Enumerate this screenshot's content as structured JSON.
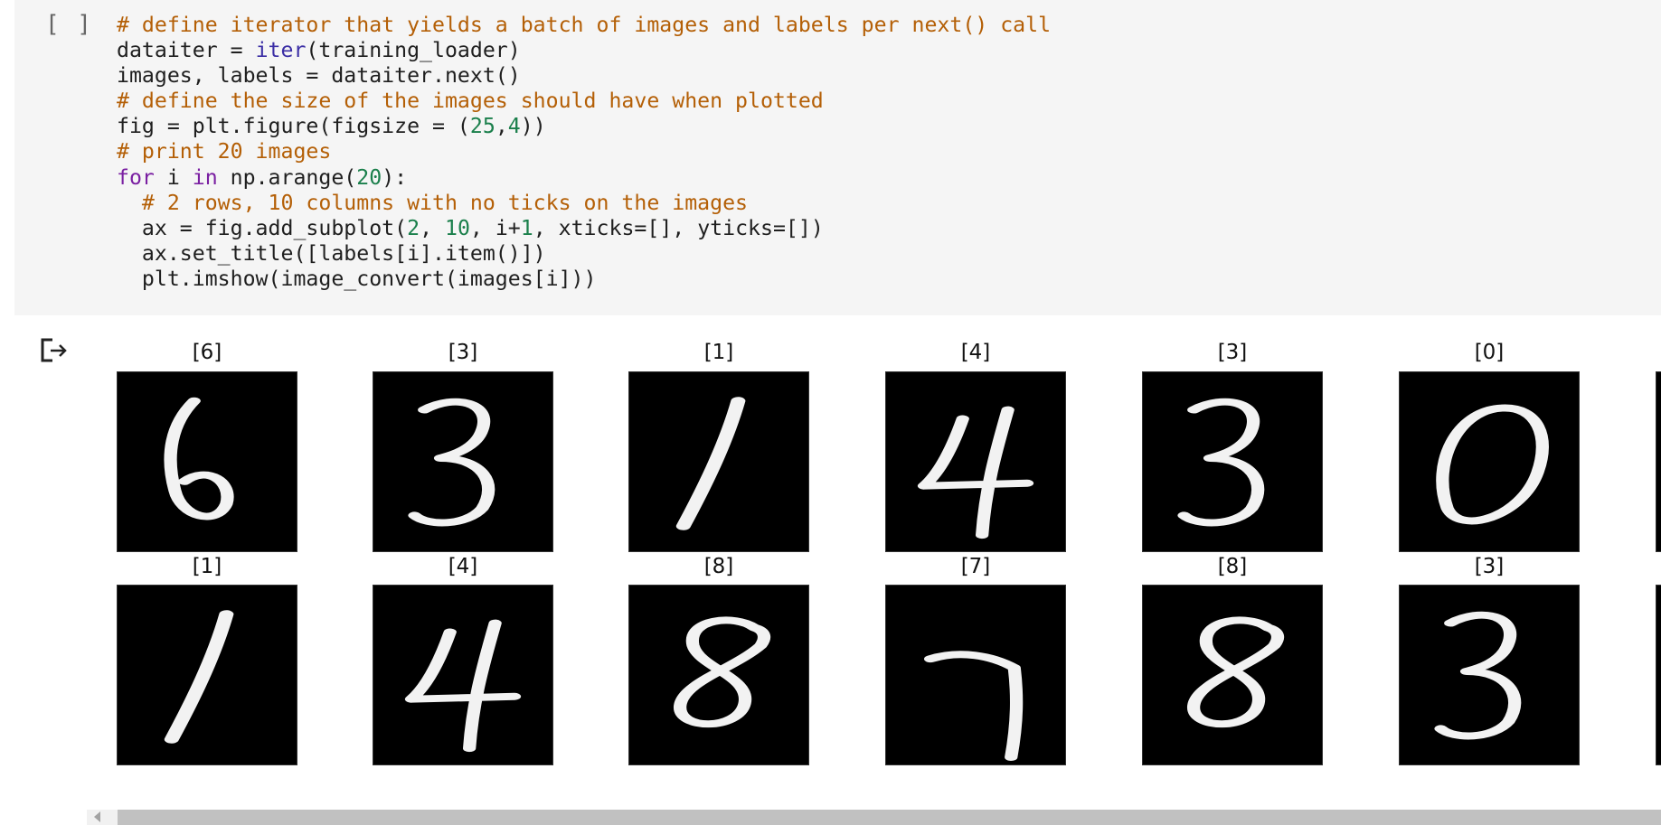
{
  "cell": {
    "run_indicator": "[ ]",
    "code_lines": [
      [
        {
          "t": "c",
          "s": "# define iterator that yields a batch of images and labels per next() call"
        }
      ],
      [
        {
          "t": "x",
          "s": "dataiter = "
        },
        {
          "t": "b",
          "s": "iter"
        },
        {
          "t": "x",
          "s": "(training_loader)"
        }
      ],
      [
        {
          "t": "x",
          "s": "images, labels = dataiter.next()"
        }
      ],
      [
        {
          "t": "c",
          "s": "# define the size of the images should have when plotted"
        }
      ],
      [
        {
          "t": "x",
          "s": "fig = plt.figure(figsize = ("
        },
        {
          "t": "n",
          "s": "25"
        },
        {
          "t": "x",
          "s": ","
        },
        {
          "t": "n",
          "s": "4"
        },
        {
          "t": "x",
          "s": "))"
        }
      ],
      [
        {
          "t": "c",
          "s": "# print 20 images"
        }
      ],
      [
        {
          "t": "k",
          "s": "for"
        },
        {
          "t": "x",
          "s": " i "
        },
        {
          "t": "k",
          "s": "in"
        },
        {
          "t": "x",
          "s": " np.arange("
        },
        {
          "t": "n",
          "s": "20"
        },
        {
          "t": "x",
          "s": "):"
        }
      ],
      [
        {
          "t": "x",
          "s": "  "
        },
        {
          "t": "c",
          "s": "# 2 rows, 10 columns with no ticks on the images"
        }
      ],
      [
        {
          "t": "x",
          "s": "  ax = fig.add_subplot("
        },
        {
          "t": "n",
          "s": "2"
        },
        {
          "t": "x",
          "s": ", "
        },
        {
          "t": "n",
          "s": "10"
        },
        {
          "t": "x",
          "s": ", i+"
        },
        {
          "t": "n",
          "s": "1"
        },
        {
          "t": "x",
          "s": ", xticks=[], yticks=[])"
        }
      ],
      [
        {
          "t": "x",
          "s": "  ax.set_title([labels[i].item()])"
        }
      ],
      [
        {
          "t": "x",
          "s": "  plt.imshow(image_convert(images[i]))"
        }
      ]
    ]
  },
  "output": {
    "icon": "output-redirect-icon",
    "panels": [
      {
        "title": "[6]",
        "digit": "6"
      },
      {
        "title": "[3]",
        "digit": "3"
      },
      {
        "title": "[1]",
        "digit": "1"
      },
      {
        "title": "[4]",
        "digit": "4"
      },
      {
        "title": "[3]",
        "digit": "3"
      },
      {
        "title": "[0]",
        "digit": "0"
      },
      {
        "title": "[1]",
        "digit": "1"
      },
      {
        "title": "[4]",
        "digit": "4"
      },
      {
        "title": "[8]",
        "digit": "8"
      },
      {
        "title": "[7]",
        "digit": "7"
      },
      {
        "title": "[8]",
        "digit": "8"
      },
      {
        "title": "[3]",
        "digit": "3"
      }
    ]
  },
  "colors": {
    "cell_background": "#f5f5f5",
    "comment": "#b45f06",
    "keyword": "#7a1fa2",
    "number": "#1a7f4b",
    "image_background": "#000000",
    "digit_stroke": "#f2f2f2"
  }
}
